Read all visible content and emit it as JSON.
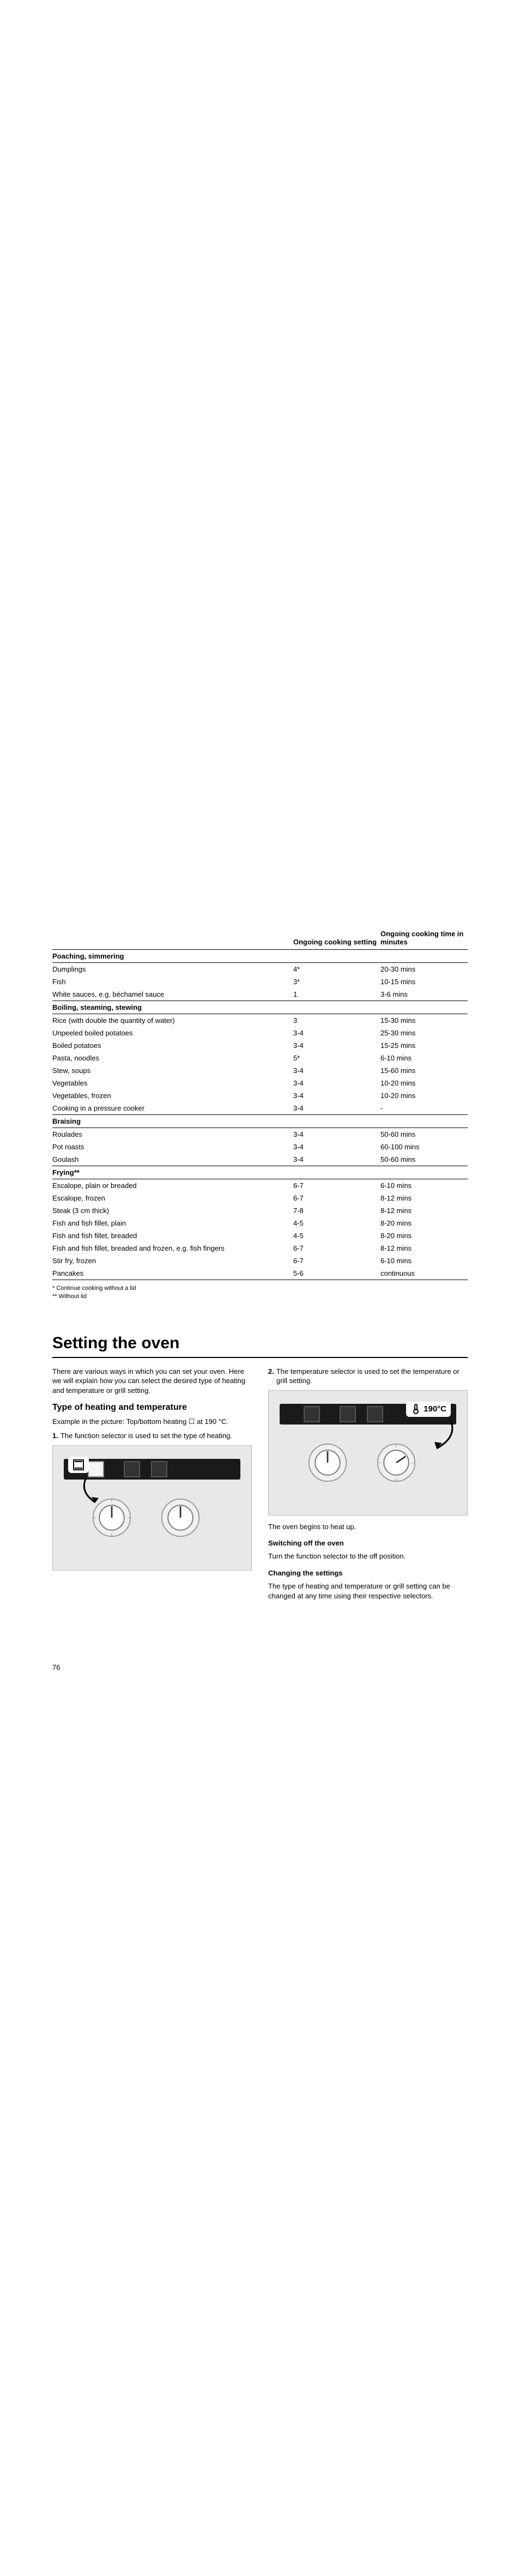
{
  "table": {
    "headers": {
      "item": "",
      "setting": "Ongoing cooking setting",
      "time": "Ongoing cooking time in minutes"
    },
    "sections": [
      {
        "title": "Poaching, simmering",
        "rows": [
          {
            "item": "Dumplings",
            "setting": "4*",
            "time": "20-30 mins"
          },
          {
            "item": "Fish",
            "setting": "3*",
            "time": "10-15 mins"
          },
          {
            "item": "White sauces, e.g. béchamel sauce",
            "setting": "1",
            "time": "3-6 mins"
          }
        ]
      },
      {
        "title": "Boiling, steaming, stewing",
        "rows": [
          {
            "item": "Rice (with double the quantity of water)",
            "setting": "3",
            "time": "15-30 mins"
          },
          {
            "item": "Unpeeled boiled potatoes",
            "setting": "3-4",
            "time": "25-30 mins"
          },
          {
            "item": "Boiled potatoes",
            "setting": "3-4",
            "time": "15-25 mins"
          },
          {
            "item": "Pasta, noodles",
            "setting": "5*",
            "time": "6-10 mins"
          },
          {
            "item": "Stew, soups",
            "setting": "3-4",
            "time": "15-60 mins"
          },
          {
            "item": "Vegetables",
            "setting": "3-4",
            "time": "10-20 mins"
          },
          {
            "item": "Vegetables, frozen",
            "setting": "3-4",
            "time": "10-20 mins"
          },
          {
            "item": "Cooking in a pressure cooker",
            "setting": "3-4",
            "time": "-"
          }
        ]
      },
      {
        "title": "Braising",
        "rows": [
          {
            "item": "Roulades",
            "setting": "3-4",
            "time": "50-60 mins"
          },
          {
            "item": "Pot roasts",
            "setting": "3-4",
            "time": "60-100 mins"
          },
          {
            "item": "Goulash",
            "setting": "3-4",
            "time": "50-60 mins"
          }
        ]
      },
      {
        "title": "Frying**",
        "rows": [
          {
            "item": "Escalope, plain or breaded",
            "setting": "6-7",
            "time": "6-10 mins"
          },
          {
            "item": "Escalope, frozen",
            "setting": "6-7",
            "time": "8-12 mins"
          },
          {
            "item": "Steak (3 cm thick)",
            "setting": "7-8",
            "time": "8-12 mins"
          },
          {
            "item": "Fish and fish fillet, plain",
            "setting": "4-5",
            "time": "8-20 mins"
          },
          {
            "item": "Fish and fish fillet, breaded",
            "setting": "4-5",
            "time": "8-20 mins"
          },
          {
            "item": "Fish and fish fillet, breaded and frozen, e.g. fish fingers",
            "setting": "6-7",
            "time": "8-12 mins"
          },
          {
            "item": "Stir fry, frozen",
            "setting": "6-7",
            "time": "6-10 mins"
          },
          {
            "item": "Pancakes",
            "setting": "5-6",
            "time": "continuous"
          }
        ]
      }
    ],
    "footnotes": {
      "a": "*   Continue cooking without a lid",
      "b": "** Without lid"
    }
  },
  "setting_oven": {
    "title": "Setting the oven",
    "intro": "There are various ways in which you can set your oven. Here we will explain how you can select the desired type of heating and temperature or grill setting.",
    "h2": "Type of heating and temperature",
    "example": "Example in the picture: Top/bottom heating ☐ at 190 °C.",
    "step1_num": "1.",
    "step1": "The function selector is used to set the type of heating.",
    "step2_num": "2.",
    "step2": "The temperature selector is used to set the temperature or grill setting.",
    "bubble": "190°C",
    "heat_note": "The oven begins to heat up.",
    "switch_h": "Switching off the oven",
    "switch_t": "Turn the function selector to the off position.",
    "change_h": "Changing the settings",
    "change_t": "The type of heating and temperature or grill setting can be changed at any time using their respective selectors."
  },
  "page_number": "76"
}
